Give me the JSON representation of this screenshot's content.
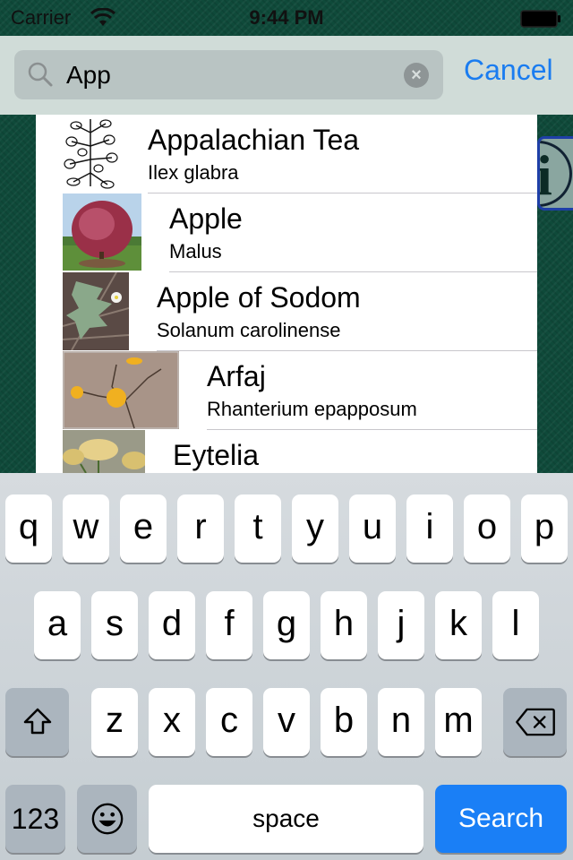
{
  "status_bar": {
    "carrier": "Carrier",
    "time": "9:44 PM",
    "wifi_icon": "wifi-icon",
    "battery_icon": "battery-full-icon"
  },
  "search": {
    "value": "App",
    "placeholder": "",
    "cancel_label": "Cancel",
    "icon": "search-icon",
    "clear_icon": "clear-icon"
  },
  "info_button": {
    "icon": "info-icon",
    "glyph": "i"
  },
  "results": [
    {
      "name": "Appalachian Tea",
      "scientific": "Ilex glabra"
    },
    {
      "name": "Apple",
      "scientific": "Malus"
    },
    {
      "name": "Apple of Sodom",
      "scientific": "Solanum carolinense"
    },
    {
      "name": "Arfaj",
      "scientific": "Rhanterium epapposum"
    },
    {
      "name": "Eytelia",
      "scientific": ""
    }
  ],
  "keyboard": {
    "row1": [
      "q",
      "w",
      "e",
      "r",
      "t",
      "y",
      "u",
      "i",
      "o",
      "p"
    ],
    "row2": [
      "a",
      "s",
      "d",
      "f",
      "g",
      "h",
      "j",
      "k",
      "l"
    ],
    "row3": [
      "z",
      "x",
      "c",
      "v",
      "b",
      "n",
      "m"
    ],
    "numbers_label": "123",
    "space_label": "space",
    "search_label": "Search",
    "shift_icon": "shift-icon",
    "delete_icon": "delete-icon",
    "emoji_icon": "emoji-icon"
  },
  "colors": {
    "accent": "#1a7cf0",
    "search_key": "#1a7ff6",
    "background": "#0f4a3a"
  }
}
